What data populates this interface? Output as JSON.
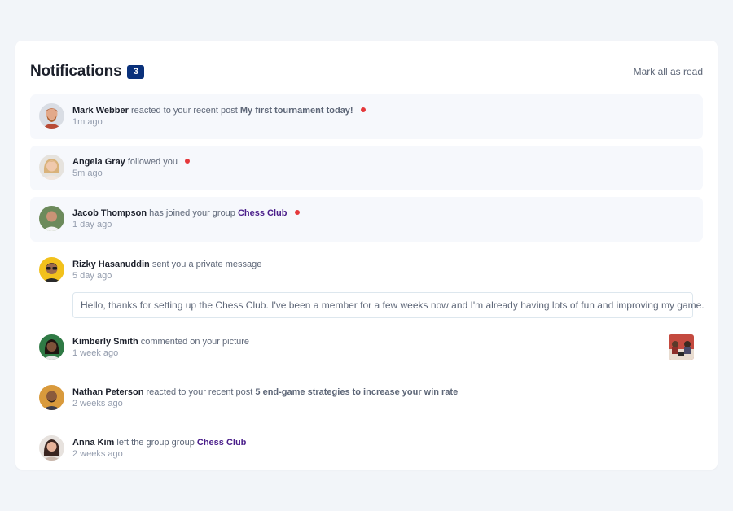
{
  "header": {
    "title": "Notifications",
    "unread_count": "3",
    "mark_all_label": "Mark all as read"
  },
  "notifications": [
    {
      "name": "Mark Webber",
      "action": "reacted to your recent post",
      "target": "My first tournament today!",
      "time": "1m ago",
      "unread": true,
      "avatar_icon": "avatar-mark-webber"
    },
    {
      "name": "Angela Gray",
      "action": "followed you",
      "target": "",
      "time": "5m ago",
      "unread": true,
      "avatar_icon": "avatar-angela-gray"
    },
    {
      "name": "Jacob Thompson",
      "action": "has joined your group",
      "target": "Chess Club",
      "time": "1 day ago",
      "unread": true,
      "avatar_icon": "avatar-jacob-thompson"
    },
    {
      "name": "Rizky Hasanuddin",
      "action": "sent you a private message",
      "target": "",
      "time": "5 day ago",
      "unread": false,
      "message": "Hello, thanks for setting up the Chess Club. I've been a member for a few weeks now and I'm already having lots of fun and improving my game.",
      "avatar_icon": "avatar-rizky-hasanuddin"
    },
    {
      "name": "Kimberly Smith",
      "action": "commented on your picture",
      "target": "",
      "time": "1 week ago",
      "unread": false,
      "avatar_icon": "avatar-kimberly-smith",
      "picture_icon": "chess-picture-thumbnail"
    },
    {
      "name": "Nathan Peterson",
      "action": "reacted to your recent post",
      "target": "5 end-game strategies to increase your win rate",
      "time": "2 weeks ago",
      "unread": false,
      "avatar_icon": "avatar-nathan-peterson"
    },
    {
      "name": "Anna Kim",
      "action": "left the group group",
      "target": "Chess Club",
      "time": "2 weeks ago",
      "unread": false,
      "avatar_icon": "avatar-anna-kim"
    }
  ],
  "colors": {
    "background": "#f2f5f9",
    "badge": "#0a317b",
    "unread_bg": "#f6f8fc",
    "dot": "#e5383b",
    "group_link": "#4a1e8a",
    "name": "#1c202b"
  }
}
